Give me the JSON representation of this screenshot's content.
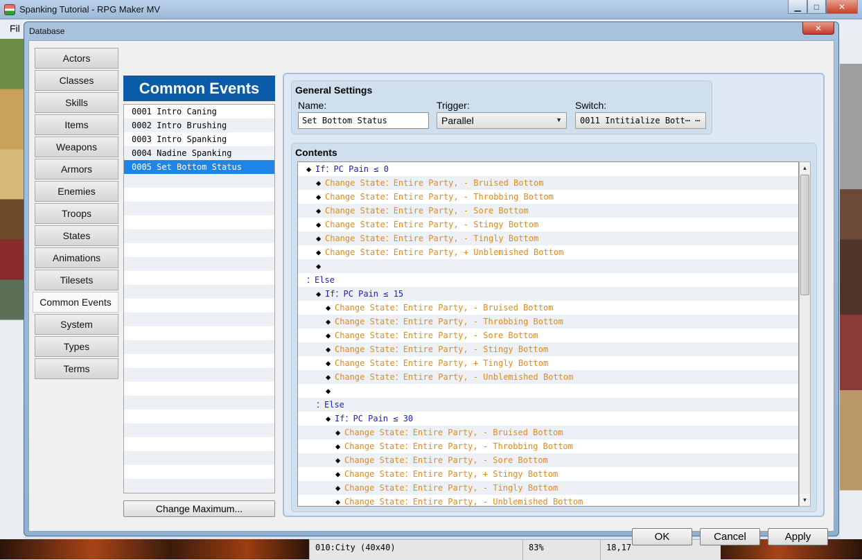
{
  "app": {
    "title": "Spanking Tutorial - RPG Maker MV",
    "menu_first_letters": "Fil",
    "caption_min": "▁",
    "caption_max": "□",
    "caption_close": "✕"
  },
  "status_bar": {
    "map": "010:City (40x40)",
    "zoom": "83%",
    "coords": "18,17"
  },
  "dialog": {
    "title": "Database",
    "close": "✕",
    "tabs": [
      "Actors",
      "Classes",
      "Skills",
      "Items",
      "Weapons",
      "Armors",
      "Enemies",
      "Troops",
      "States",
      "Animations",
      "Tilesets",
      "Common Events",
      "System",
      "Types",
      "Terms"
    ],
    "active_tab": "Common Events",
    "list_header": "Common Events",
    "events": [
      "0001 Intro Caning",
      "0002 Intro Brushing",
      "0003 Intro Spanking",
      "0004 Nadine Spanking",
      "0005 Set Bottom Status"
    ],
    "selected_event": 4,
    "change_max": "Change Maximum...",
    "general": {
      "title": "General Settings",
      "name_label": "Name:",
      "name_value": "Set Bottom Status",
      "trigger_label": "Trigger:",
      "trigger_value": "Parallel",
      "switch_label": "Switch:",
      "switch_value": "0011 Intitialize Bott⋯ ⋯"
    },
    "contents": {
      "title": "Contents",
      "commands": [
        {
          "indent": 0,
          "diamond": true,
          "kind": "blue",
          "text": "If：PC Pain ≤ 0"
        },
        {
          "indent": 1,
          "diamond": true,
          "kind": "orange",
          "text": "Change State：Entire Party, - Bruised Bottom"
        },
        {
          "indent": 1,
          "diamond": true,
          "kind": "orange",
          "text": "Change State：Entire Party, - Throbbing Bottom"
        },
        {
          "indent": 1,
          "diamond": true,
          "kind": "orange",
          "text": "Change State：Entire Party, - Sore Bottom"
        },
        {
          "indent": 1,
          "diamond": true,
          "kind": "orange",
          "text": "Change State：Entire Party, - Stingy Bottom"
        },
        {
          "indent": 1,
          "diamond": true,
          "kind": "orange",
          "text": "Change State：Entire Party, - Tingly Bottom"
        },
        {
          "indent": 1,
          "diamond": true,
          "kind": "orange",
          "text": "Change State：Entire Party, + Unblemished Bottom"
        },
        {
          "indent": 1,
          "diamond": true,
          "kind": "orange",
          "text": ""
        },
        {
          "indent": 0,
          "diamond": false,
          "kind": "blue",
          "text": "：Else"
        },
        {
          "indent": 1,
          "diamond": true,
          "kind": "blue",
          "text": "If：PC Pain ≤ 15"
        },
        {
          "indent": 2,
          "diamond": true,
          "kind": "orange",
          "text": "Change State：Entire Party, - Bruised Bottom"
        },
        {
          "indent": 2,
          "diamond": true,
          "kind": "orange",
          "text": "Change State：Entire Party, - Throbbing Bottom"
        },
        {
          "indent": 2,
          "diamond": true,
          "kind": "orange",
          "text": "Change State：Entire Party, - Sore Bottom"
        },
        {
          "indent": 2,
          "diamond": true,
          "kind": "orange",
          "text": "Change State：Entire Party, - Stingy Bottom"
        },
        {
          "indent": 2,
          "diamond": true,
          "kind": "orange",
          "text": "Change State：Entire Party, + Tingly Bottom"
        },
        {
          "indent": 2,
          "diamond": true,
          "kind": "orange",
          "text": "Change State：Entire Party, - Unblemished Bottom"
        },
        {
          "indent": 2,
          "diamond": true,
          "kind": "orange",
          "text": ""
        },
        {
          "indent": 1,
          "diamond": false,
          "kind": "blue",
          "text": "：Else"
        },
        {
          "indent": 2,
          "diamond": true,
          "kind": "blue",
          "text": "If：PC Pain ≤ 30"
        },
        {
          "indent": 3,
          "diamond": true,
          "kind": "orange",
          "text": "Change State：Entire Party, - Bruised Bottom"
        },
        {
          "indent": 3,
          "diamond": true,
          "kind": "orange",
          "text": "Change State：Entire Party, - Throbbing Bottom"
        },
        {
          "indent": 3,
          "diamond": true,
          "kind": "orange",
          "text": "Change State：Entire Party, - Sore Bottom"
        },
        {
          "indent": 3,
          "diamond": true,
          "kind": "orange",
          "text": "Change State：Entire Party, + Stingy Bottom"
        },
        {
          "indent": 3,
          "diamond": true,
          "kind": "orange",
          "text": "Change State：Entire Party, - Tingly Bottom"
        },
        {
          "indent": 3,
          "diamond": true,
          "kind": "orange",
          "text": "Change State：Entire Party, - Unblemished Bottom"
        }
      ]
    },
    "buttons": {
      "ok": "OK",
      "cancel": "Cancel",
      "apply": "Apply"
    }
  },
  "colors": {
    "header_blue": "#0a5ca8",
    "selection": "#1e86e8",
    "command_blue": "#1a1ad0",
    "command_orange": "#e88a10"
  },
  "icons": {
    "dropdown": "chevron-down-icon",
    "scroll_up": "arrow-up-icon",
    "scroll_down": "arrow-down-icon"
  }
}
